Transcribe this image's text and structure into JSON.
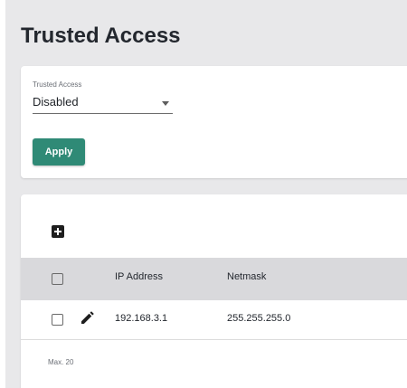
{
  "page": {
    "title": "Trusted Access"
  },
  "settings": {
    "trusted_access_label": "Trusted Access",
    "trusted_access_value": "Disabled",
    "apply_label": "Apply"
  },
  "table": {
    "columns": [
      "",
      "",
      "IP Address",
      "Netmask"
    ],
    "rows": [
      {
        "ip_address": "192.168.3.1",
        "netmask": "255.255.255.0"
      }
    ],
    "footer": "Max. 20"
  },
  "icons": {
    "add": "add-box-icon",
    "edit": "pencil-icon",
    "dropdown": "caret-down-icon"
  },
  "colors": {
    "primary": "#2f8a76",
    "page_background": "#e8e8ea",
    "table_header_background": "#d9d9dc"
  }
}
